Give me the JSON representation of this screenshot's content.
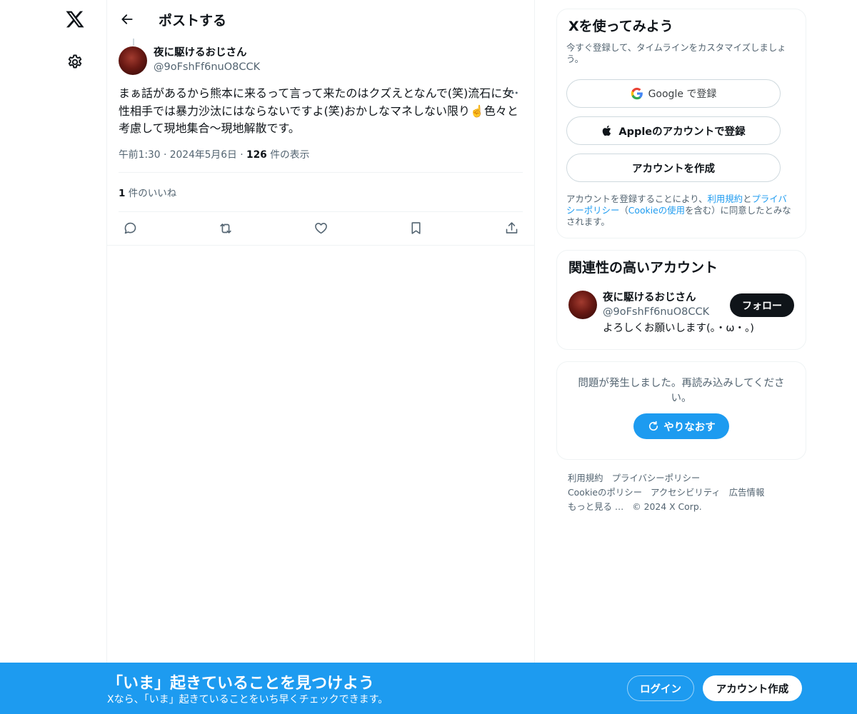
{
  "colors": {
    "accent": "#1d9bf0",
    "text": "#0f1419",
    "muted": "#536471",
    "border": "#eff3f4"
  },
  "nav": {
    "logo_icon": "x-logo-icon",
    "settings_icon": "gear-icon"
  },
  "header": {
    "title": "ポストする",
    "back_icon": "arrow-left-icon"
  },
  "post": {
    "author_name": "夜に駆けるおじさん",
    "author_handle": "@9oFshFf6nuO8CCK",
    "more_icon": "more-dots-icon",
    "text": "まぁ話があるから熊本に来るって言って来たのはクズえとなんで(笑)流石に女性相手では暴力沙汰にはならないですよ(笑)おかしなマネしない限り☝️色々と考慮して現地集合〜現地解散です。",
    "time": "午前1:30",
    "date": "2024年5月6日",
    "views_count": "126",
    "views_label": "件の表示",
    "likes_count": "1",
    "likes_label": "件のいいね",
    "actions": [
      "reply-icon",
      "repost-icon",
      "like-icon",
      "bookmark-icon",
      "share-icon"
    ]
  },
  "signup": {
    "title": "Xを使ってみよう",
    "subtitle": "今すぐ登録して、タイムラインをカスタマイズしましょう。",
    "google_label": "Google で登録",
    "apple_label": "Appleのアカウントで登録",
    "create_label": "アカウントを作成",
    "terms_prefix": "アカウントを登録することにより、",
    "terms_link": "利用規約",
    "terms_and": "と",
    "privacy_link": "プライバシーポリシー",
    "terms_paren_open": "（",
    "cookie_link": "Cookieの使用",
    "terms_suffix": "を含む）に同意したとみなされます。"
  },
  "related": {
    "title": "関連性の高いアカウント",
    "name": "夜に駆けるおじさん",
    "handle": "@9oFshFf6nuO8CCK",
    "bio": "よろしくお願いします(。・ω・。)",
    "follow_label": "フォロー"
  },
  "error": {
    "message": "問題が発生しました。再読み込みしてください。",
    "retry_label": "やりなおす"
  },
  "footer": {
    "links_row1": [
      "利用規約",
      "プライバシーポリシー"
    ],
    "links_row2": [
      "Cookieのポリシー",
      "アクセシビリティ",
      "広告情報"
    ],
    "more": "もっと見る …",
    "copyright": "© 2024 X Corp."
  },
  "bottom_bar": {
    "title": "「いま」起きていることを見つけよう",
    "subtitle": "Xなら、「いま」起きていることをいち早くチェックできます。",
    "login_label": "ログイン",
    "create_label": "アカウント作成"
  }
}
